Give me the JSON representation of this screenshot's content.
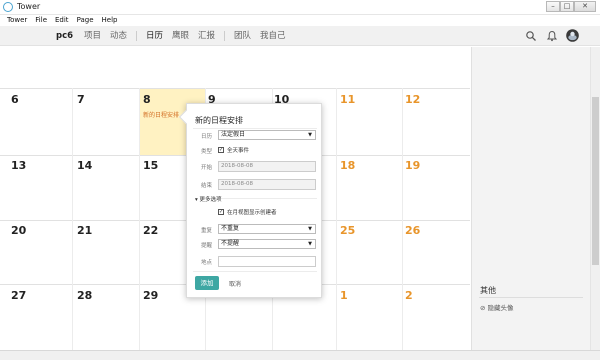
{
  "window": {
    "title": "Tower",
    "min_label": "–",
    "max_label": "□",
    "close_label": "✕"
  },
  "menu": [
    "Tower",
    "File",
    "Edit",
    "Page",
    "Help"
  ],
  "nav": {
    "project": "pc6",
    "items": [
      "项目",
      "动态",
      "日历",
      "鹰眼",
      "汇报",
      "团队",
      "我自己"
    ],
    "active": "日历"
  },
  "calendar": {
    "weeks": [
      {
        "days": [
          "6",
          "7",
          "8",
          "9",
          "10",
          "11",
          "12"
        ]
      },
      {
        "days": [
          "13",
          "14",
          "15",
          "",
          "",
          "18",
          "19"
        ]
      },
      {
        "days": [
          "20",
          "21",
          "22",
          "",
          "",
          "25",
          "26"
        ]
      },
      {
        "days": [
          "27",
          "28",
          "29",
          "",
          "",
          "1",
          "2"
        ]
      }
    ],
    "highlighted_day": "8",
    "event_label": "新的日程安排",
    "weekend_color": "#e8952b",
    "highlight_color": "#fff2c2"
  },
  "dialog": {
    "title": "新的日程安排",
    "date_label": "日历",
    "date_value": "法定假日",
    "type_label": "类型",
    "allday_label": "全天事件",
    "start_label": "开始",
    "start_value": "2018-08-08",
    "end_label": "结束",
    "end_value": "2018-08-08",
    "more_label": "更多选项",
    "show_creator_label": "在月视图显示创建者",
    "repeat_label": "重复",
    "repeat_value": "不重复",
    "remind_label": "提醒",
    "remind_value": "不提醒",
    "location_label": "地点",
    "location_value": "",
    "add_label": "添加",
    "cancel_label": "取消",
    "add_color": "#3ea7a3"
  },
  "sidebar": {
    "title": "其他",
    "link": "隐藏头像"
  }
}
